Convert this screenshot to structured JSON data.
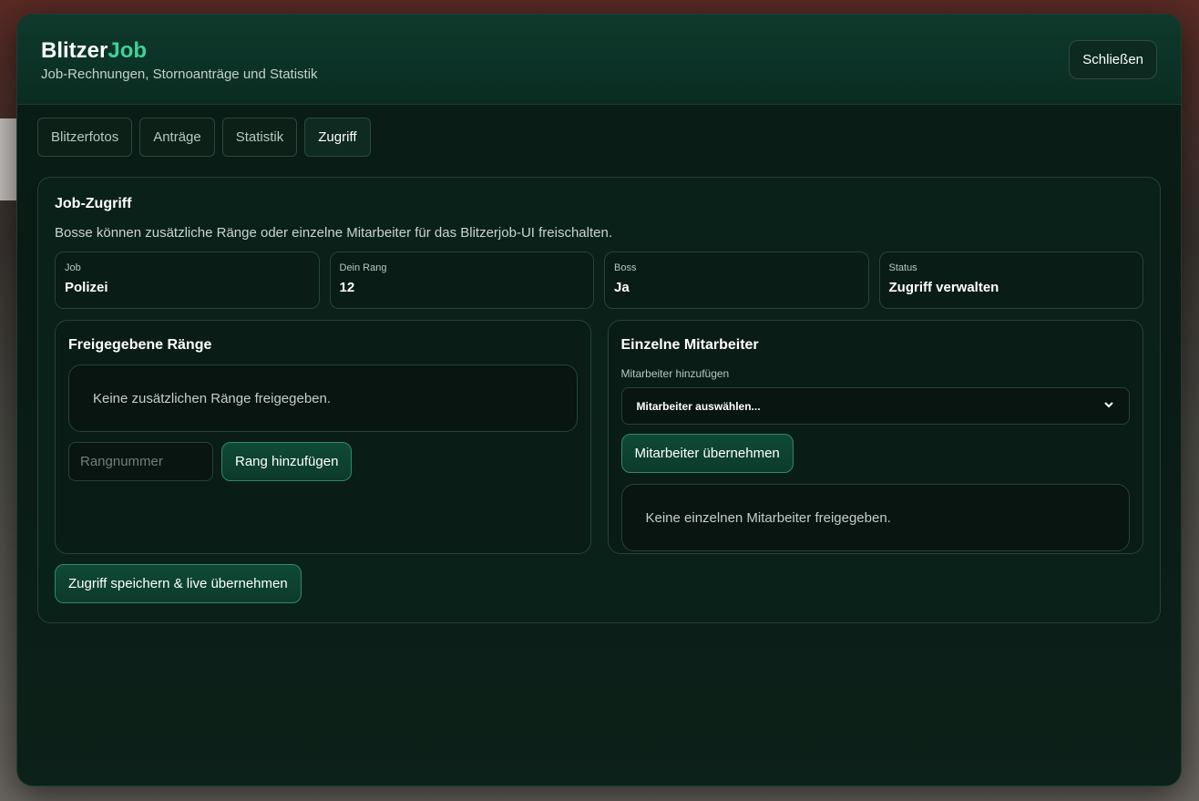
{
  "header": {
    "brand_part1": "Blitzer",
    "brand_part2": "Job",
    "subtitle": "Job-Rechnungen, Stornoanträge und Statistik",
    "close_label": "Schließen"
  },
  "tabs": [
    {
      "label": "Blitzerfotos",
      "active": false
    },
    {
      "label": "Anträge",
      "active": false
    },
    {
      "label": "Statistik",
      "active": false
    },
    {
      "label": "Zugriff",
      "active": true
    }
  ],
  "card": {
    "title": "Job-Zugriff",
    "description": "Bosse können zusätzliche Ränge oder einzelne Mitarbeiter für das Blitzerjob-UI freischalten.",
    "stats": [
      {
        "label": "Job",
        "value": "Polizei"
      },
      {
        "label": "Dein Rang",
        "value": "12"
      },
      {
        "label": "Boss",
        "value": "Ja"
      },
      {
        "label": "Status",
        "value": "Zugriff verwalten"
      }
    ],
    "ranks_panel": {
      "title": "Freigegebene Ränge",
      "empty_text": "Keine zusätzlichen Ränge freigegeben.",
      "input_placeholder": "Rangnummer",
      "add_button": "Rang hinzufügen"
    },
    "employees_panel": {
      "title": "Einzelne Mitarbeiter",
      "field_label": "Mitarbeiter hinzufügen",
      "select_value": "Mitarbeiter auswählen...",
      "apply_button": "Mitarbeiter übernehmen",
      "empty_text": "Keine einzelnen Mitarbeiter freigegeben."
    },
    "save_button": "Zugriff speichern & live übernehmen"
  },
  "colors": {
    "accent": "#3fd19a",
    "background": "#0a1a14",
    "button_green": "#0f4a36"
  }
}
